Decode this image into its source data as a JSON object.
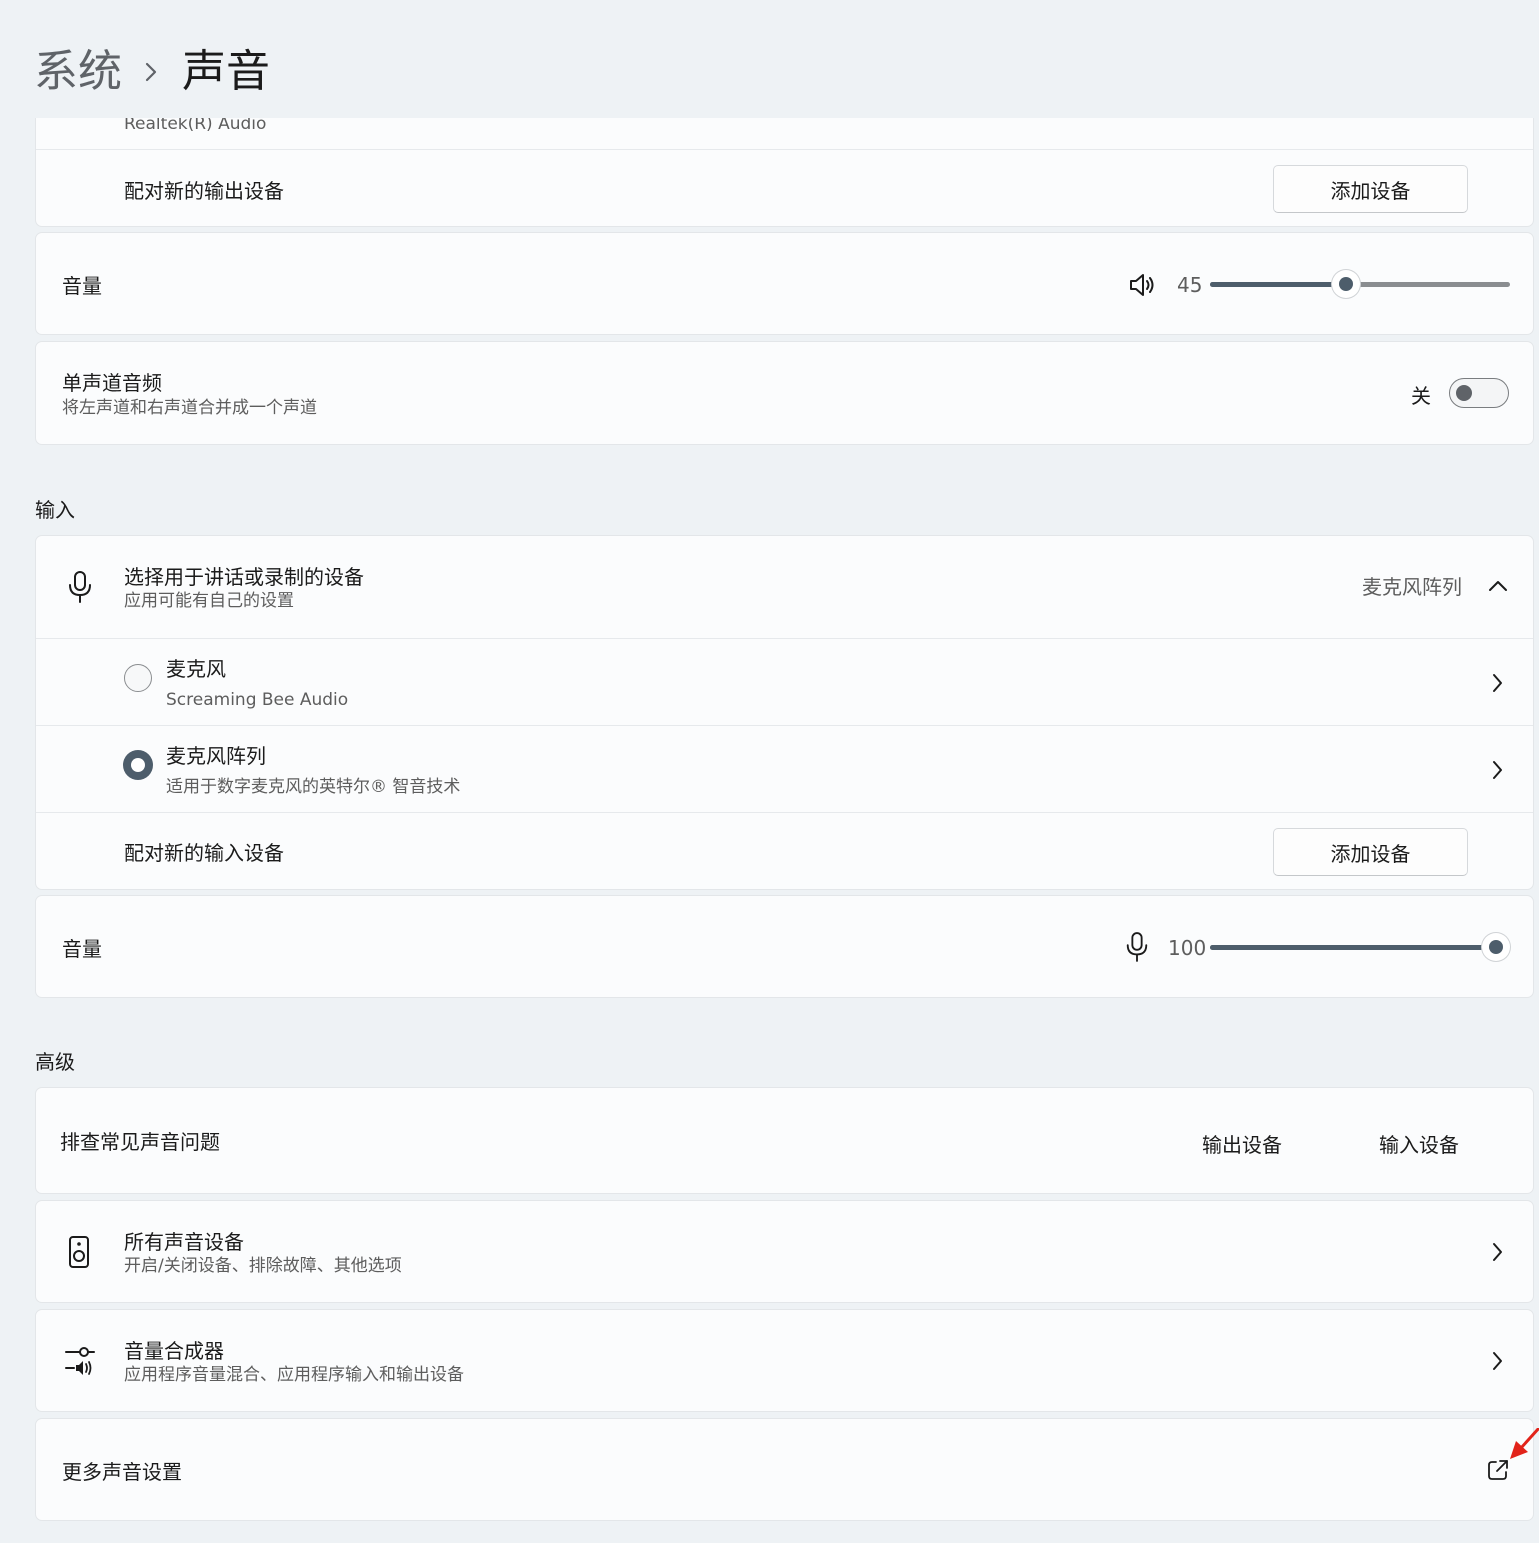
{
  "breadcrumb": {
    "parent": "系统",
    "current": "声音"
  },
  "output": {
    "device_subtitle": "Realtek(R) Audio",
    "pair_label": "配对新的输出设备",
    "add_button": "添加设备",
    "volume_label": "音量",
    "volume_value": "45",
    "volume_level": 45,
    "mono_title": "单声道音频",
    "mono_subtitle": "将左声道和右声道合并成一个声道",
    "mono_state": "关"
  },
  "input": {
    "section_title": "输入",
    "select_title": "选择用于讲话或录制的设备",
    "select_subtitle": "应用可能有自己的设置",
    "selected_device": "麦克风阵列",
    "devices": [
      {
        "name": "麦克风",
        "detail": "Screaming Bee Audio",
        "selected": false
      },
      {
        "name": "麦克风阵列",
        "detail": "适用于数字麦克风的英特尔® 智音技术",
        "selected": true
      }
    ],
    "pair_label": "配对新的输入设备",
    "add_button": "添加设备",
    "volume_label": "音量",
    "volume_value": "100",
    "volume_level": 100
  },
  "advanced": {
    "section_title": "高级",
    "troubleshoot_title": "排查常见声音问题",
    "troubleshoot_output": "输出设备",
    "troubleshoot_input": "输入设备",
    "all_devices_title": "所有声音设备",
    "all_devices_subtitle": "开启/关闭设备、排除故障、其他选项",
    "mixer_title": "音量合成器",
    "mixer_subtitle": "应用程序音量混合、应用程序输入和输出设备",
    "more_settings_title": "更多声音设置"
  },
  "icons": {
    "speaker": "speaker-icon",
    "microphone": "microphone-icon",
    "chevron_up": "chevron-up-icon",
    "chevron_right": "chevron-right-icon",
    "speaker_device": "speaker-device-icon",
    "mixer": "mixer-icon",
    "open_external": "open-external-icon",
    "annotation_arrow": "red-arrow-icon"
  },
  "colors": {
    "accent": "#4d5d6b",
    "annotation": "#e2231a",
    "background": "#eef2f5",
    "card": "#fbfcfd"
  }
}
